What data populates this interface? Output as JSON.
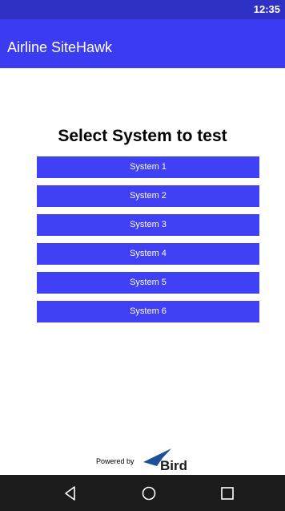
{
  "status_bar": {
    "time": "12:35"
  },
  "app_bar": {
    "title": "Airline SiteHawk"
  },
  "main": {
    "heading": "Select System to test",
    "systems": [
      {
        "label": "System 1"
      },
      {
        "label": "System 2"
      },
      {
        "label": "System 3"
      },
      {
        "label": "System 4"
      },
      {
        "label": "System 5"
      },
      {
        "label": "System 6"
      }
    ]
  },
  "footer": {
    "powered_by": "Powered by",
    "logo_text": "Bird"
  },
  "nav": {
    "icons": [
      "back-icon",
      "home-icon",
      "recent-apps-icon"
    ]
  },
  "colors": {
    "status_bar": "#2f30c4",
    "app_bar": "#3b3cf2",
    "button": "#4040f4",
    "nav_bar": "#1b1b1b"
  }
}
